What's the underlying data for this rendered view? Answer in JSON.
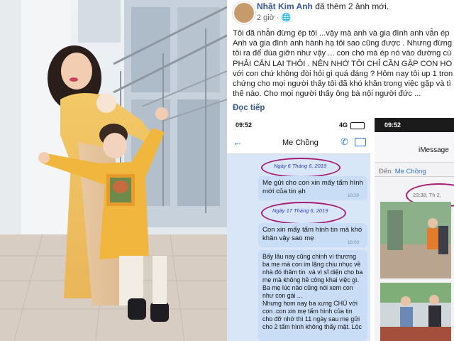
{
  "post": {
    "author": "Nhật Kim Anh",
    "action": "đã thêm 2 ảnh mới.",
    "time": "2 giờ",
    "lines": [
      "Tôi đã nhẫn đừng ép tôi ...vậy mà anh và gia đình anh vẫn ép",
      "Anh và gia đình anh hành hạ tôi sao cũng được . Nhưng đừng",
      "tôi ra để đùa giỡn như vậy ... con chó mà ép nó vào đường cù",
      "PHẢI CẮN LẠI THÔI . NÊN NHỚ TÔI CHỈ CẦN GẶP CON HO",
      "với con chứ không đòi hỏi gì quá đáng ? Hôm nay tôi up 1 tron",
      "chứng cho mọi người thấy tôi đã khó khăn trong việc gặp và tì",
      "thế nào. Cho mọi người thấy ông bà nội người đức ..."
    ],
    "see_more": "Đọc tiếp"
  },
  "shot1": {
    "time": "09:52",
    "network": "4G",
    "contact": "Me Chồng",
    "date1": "Ngày 6 Tháng 6, 2019",
    "msg1": "Mẹ gửi cho con xin mấy tấm hình mới của tin ạh",
    "msg1_time": "10:20",
    "date2": "Ngày 17 Tháng 6, 2019",
    "msg2": "Con xin mấy tấm hình tin mà khó khăn vậy sao mẹ",
    "msg2_time": "18:03",
    "msg3": "Bấy lâu nay cũng chính vì thương ba mẹ mà con im lặng chịu nhục về nhà đó thăm tin .và vì sĩ diện cho ba mẹ mà không hề công khai việc gì.",
    "msg3b": "Ba mẹ lúc nào cũng nói xem con như con gái ...",
    "msg3c": "Nhưng hom nay ba xưng CHÚ với con .con xin mẹ tấm hình của tin cho đỡ nhớ thì 11 ngày sau mẹ gửi cho 2 tấm hình không thấy mặt. Lộc"
  },
  "shot2": {
    "time": "09:52",
    "title": "iMessage",
    "to_label": "Đến:",
    "to_name": "Me Chồng",
    "stamp": "23:38, Th 2, "
  },
  "colors": {
    "link": "#385898",
    "oval": "#a31d73",
    "bubble_out": "#c9ddf6",
    "chat_bg": "#d9e6f7"
  }
}
